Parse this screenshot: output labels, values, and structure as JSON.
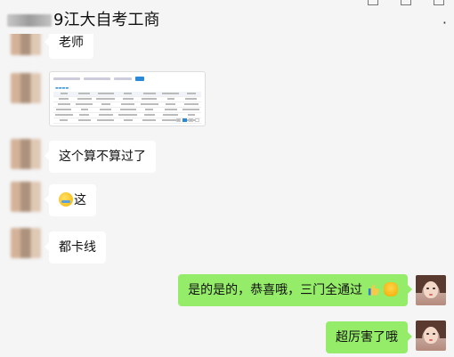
{
  "chat": {
    "title_suffix": "9江大自考工商",
    "more_icon": "more-dots-icon"
  },
  "messages": [
    {
      "from": "them",
      "type": "text",
      "text": "老师"
    },
    {
      "from": "them",
      "type": "image",
      "label": "成绩查询截图"
    },
    {
      "from": "them",
      "type": "text",
      "text": "这个算不算过了"
    },
    {
      "from": "them",
      "type": "emoji_text",
      "emoji": "face-emoji",
      "text": "这"
    },
    {
      "from": "them",
      "type": "text",
      "text": "都卡线"
    },
    {
      "from": "me",
      "type": "text",
      "text": "是的是的，恭喜哦，三门全通过",
      "emojis": [
        "thumbs-up-emoji",
        "fist-emoji"
      ]
    },
    {
      "from": "me",
      "type": "text",
      "text": "超厉害了哦"
    }
  ],
  "shot": {
    "rows": 6,
    "cols": 7
  }
}
